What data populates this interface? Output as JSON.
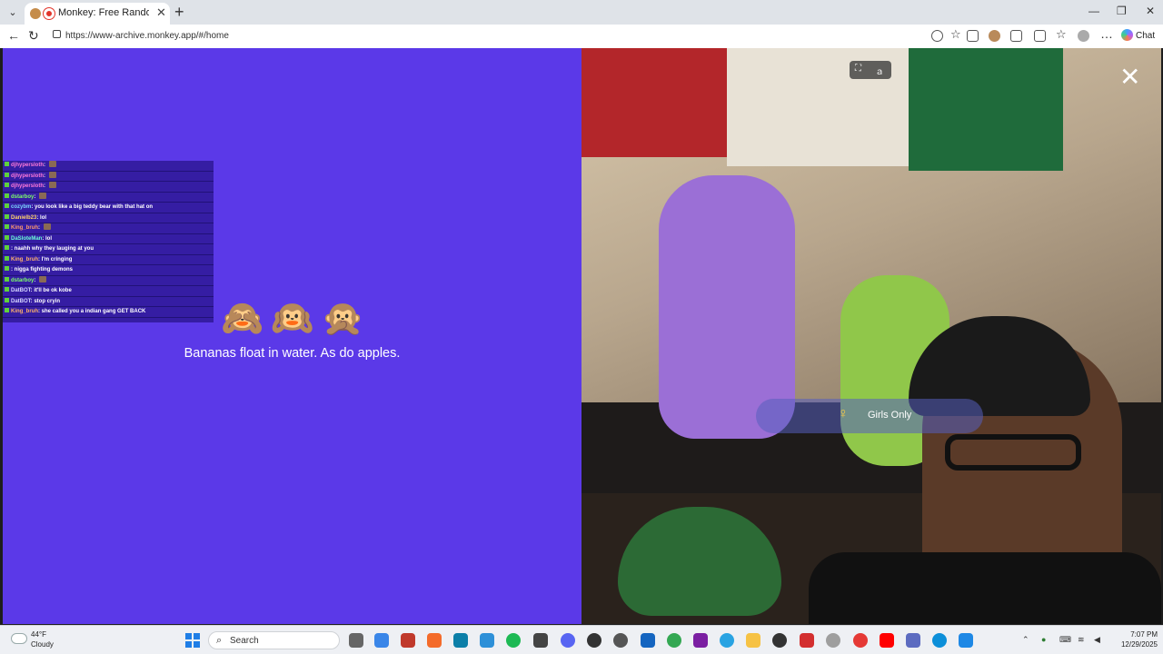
{
  "browser": {
    "tab_title": "Monkey: Free Random Video",
    "tab_close": "✕",
    "new_tab": "+",
    "url": "https://www-archive.monkey.app/#/home",
    "chat_label": "Chat"
  },
  "chat": {
    "messages": [
      {
        "user": "djhypersloth",
        "text": ""
      },
      {
        "user": "djhypersloth",
        "text": ""
      },
      {
        "user": "djhypersloth",
        "text": ""
      },
      {
        "user": "dstarboy",
        "text": ""
      },
      {
        "user": "cozybm",
        "text": "you look like a big teddy bear with that hat on"
      },
      {
        "user": "Danielb23",
        "text": "lol"
      },
      {
        "user": "King_bruh",
        "text": ""
      },
      {
        "user": "DaSloteMan",
        "text": "lol"
      },
      {
        "user": "",
        "text": "naahh why they lauging at you"
      },
      {
        "user": "King_bruh",
        "text": "I'm cringing"
      },
      {
        "user": "",
        "text": "nigga fighting demons"
      },
      {
        "user": "dstarboy",
        "text": ""
      },
      {
        "user": "DatBOT",
        "text": "it'll be ok kobe"
      },
      {
        "user": "DatBOT",
        "text": "stop cryin"
      },
      {
        "user": "King_bruh",
        "text": "she called you a indian gang GET BACK"
      }
    ]
  },
  "home": {
    "monkeys": "🙈🙉🙊",
    "tagline": "Bananas float in water. As do apples."
  },
  "video": {
    "close": "✕",
    "filter_label": "Girls Only"
  },
  "taskbar": {
    "temp": "44°F",
    "condition": "Cloudy",
    "search": "Search",
    "time": "7:07 PM",
    "date": "12/29/2025"
  },
  "colors": {
    "panel_bg": "#5b39e8",
    "tab_bg": "#dfe3e8"
  }
}
